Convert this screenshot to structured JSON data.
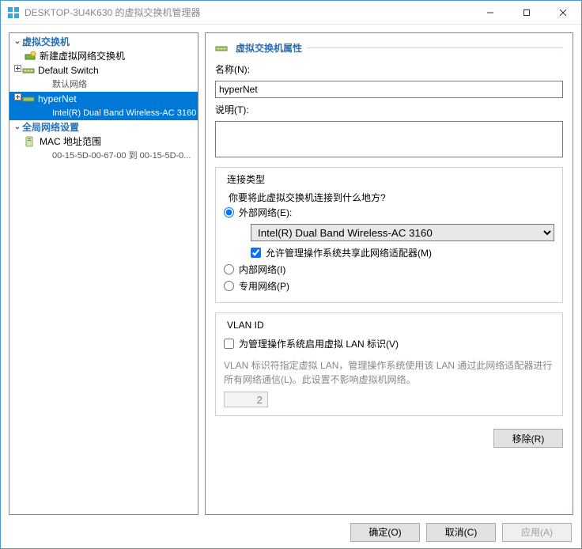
{
  "window": {
    "title": "DESKTOP-3U4K630 的虚拟交换机管理器"
  },
  "tree": {
    "section_vswitch": "虚拟交换机",
    "new_vswitch": "新建虚拟网络交换机",
    "default_switch": "Default Switch",
    "default_switch_sub": "默认网络",
    "hyperNet": "hyperNet",
    "hyperNet_sub": "Intel(R) Dual Band Wireless-AC 3160",
    "section_global": "全局网络设置",
    "mac_range": "MAC 地址范围",
    "mac_range_sub": "00-15-5D-00-67-00 到 00-15-5D-0..."
  },
  "detail": {
    "header": "虚拟交换机属性",
    "name_label": "名称(N):",
    "name_value": "hyperNet",
    "desc_label": "说明(T):",
    "desc_value": ""
  },
  "conn": {
    "group_label": "连接类型",
    "question": "你要将此虚拟交换机连接到什么地方?",
    "ext_label": "外部网络(E):",
    "ext_adapter": "Intel(R) Dual Band Wireless-AC 3160",
    "ext_share": "允许管理操作系统共享此网络适配器(M)",
    "int_label": "内部网络(I)",
    "priv_label": "专用网络(P)"
  },
  "vlan": {
    "group_label": "VLAN ID",
    "enable_label": "为管理操作系统启用虚拟 LAN 标识(V)",
    "hint": "VLAN 标识符指定虚拟 LAN，管理操作系统使用该 LAN 通过此网络适配器进行所有网络通信(L)。此设置不影响虚拟机网络。",
    "value": "2"
  },
  "buttons": {
    "remove": "移除(R)",
    "ok": "确定(O)",
    "cancel": "取消(C)",
    "apply": "应用(A)"
  }
}
